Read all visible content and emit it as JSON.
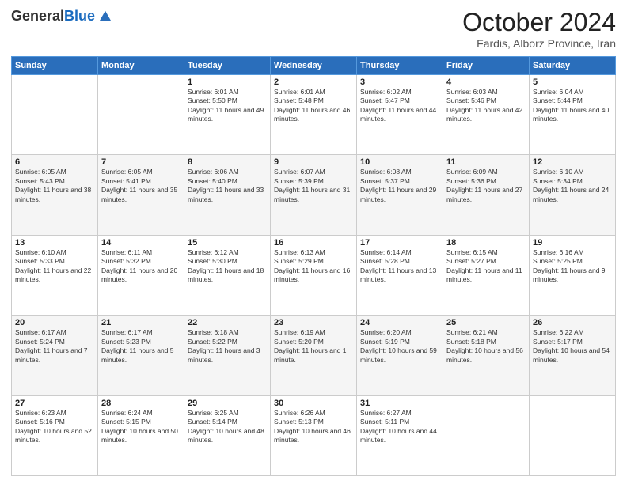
{
  "header": {
    "logo_general": "General",
    "logo_blue": "Blue",
    "month_title": "October 2024",
    "subtitle": "Fardis, Alborz Province, Iran"
  },
  "days_of_week": [
    "Sunday",
    "Monday",
    "Tuesday",
    "Wednesday",
    "Thursday",
    "Friday",
    "Saturday"
  ],
  "weeks": [
    {
      "days": [
        {
          "num": "",
          "info": ""
        },
        {
          "num": "",
          "info": ""
        },
        {
          "num": "1",
          "info": "Sunrise: 6:01 AM\nSunset: 5:50 PM\nDaylight: 11 hours and 49 minutes."
        },
        {
          "num": "2",
          "info": "Sunrise: 6:01 AM\nSunset: 5:48 PM\nDaylight: 11 hours and 46 minutes."
        },
        {
          "num": "3",
          "info": "Sunrise: 6:02 AM\nSunset: 5:47 PM\nDaylight: 11 hours and 44 minutes."
        },
        {
          "num": "4",
          "info": "Sunrise: 6:03 AM\nSunset: 5:46 PM\nDaylight: 11 hours and 42 minutes."
        },
        {
          "num": "5",
          "info": "Sunrise: 6:04 AM\nSunset: 5:44 PM\nDaylight: 11 hours and 40 minutes."
        }
      ]
    },
    {
      "days": [
        {
          "num": "6",
          "info": "Sunrise: 6:05 AM\nSunset: 5:43 PM\nDaylight: 11 hours and 38 minutes."
        },
        {
          "num": "7",
          "info": "Sunrise: 6:05 AM\nSunset: 5:41 PM\nDaylight: 11 hours and 35 minutes."
        },
        {
          "num": "8",
          "info": "Sunrise: 6:06 AM\nSunset: 5:40 PM\nDaylight: 11 hours and 33 minutes."
        },
        {
          "num": "9",
          "info": "Sunrise: 6:07 AM\nSunset: 5:39 PM\nDaylight: 11 hours and 31 minutes."
        },
        {
          "num": "10",
          "info": "Sunrise: 6:08 AM\nSunset: 5:37 PM\nDaylight: 11 hours and 29 minutes."
        },
        {
          "num": "11",
          "info": "Sunrise: 6:09 AM\nSunset: 5:36 PM\nDaylight: 11 hours and 27 minutes."
        },
        {
          "num": "12",
          "info": "Sunrise: 6:10 AM\nSunset: 5:34 PM\nDaylight: 11 hours and 24 minutes."
        }
      ]
    },
    {
      "days": [
        {
          "num": "13",
          "info": "Sunrise: 6:10 AM\nSunset: 5:33 PM\nDaylight: 11 hours and 22 minutes."
        },
        {
          "num": "14",
          "info": "Sunrise: 6:11 AM\nSunset: 5:32 PM\nDaylight: 11 hours and 20 minutes."
        },
        {
          "num": "15",
          "info": "Sunrise: 6:12 AM\nSunset: 5:30 PM\nDaylight: 11 hours and 18 minutes."
        },
        {
          "num": "16",
          "info": "Sunrise: 6:13 AM\nSunset: 5:29 PM\nDaylight: 11 hours and 16 minutes."
        },
        {
          "num": "17",
          "info": "Sunrise: 6:14 AM\nSunset: 5:28 PM\nDaylight: 11 hours and 13 minutes."
        },
        {
          "num": "18",
          "info": "Sunrise: 6:15 AM\nSunset: 5:27 PM\nDaylight: 11 hours and 11 minutes."
        },
        {
          "num": "19",
          "info": "Sunrise: 6:16 AM\nSunset: 5:25 PM\nDaylight: 11 hours and 9 minutes."
        }
      ]
    },
    {
      "days": [
        {
          "num": "20",
          "info": "Sunrise: 6:17 AM\nSunset: 5:24 PM\nDaylight: 11 hours and 7 minutes."
        },
        {
          "num": "21",
          "info": "Sunrise: 6:17 AM\nSunset: 5:23 PM\nDaylight: 11 hours and 5 minutes."
        },
        {
          "num": "22",
          "info": "Sunrise: 6:18 AM\nSunset: 5:22 PM\nDaylight: 11 hours and 3 minutes."
        },
        {
          "num": "23",
          "info": "Sunrise: 6:19 AM\nSunset: 5:20 PM\nDaylight: 11 hours and 1 minute."
        },
        {
          "num": "24",
          "info": "Sunrise: 6:20 AM\nSunset: 5:19 PM\nDaylight: 10 hours and 59 minutes."
        },
        {
          "num": "25",
          "info": "Sunrise: 6:21 AM\nSunset: 5:18 PM\nDaylight: 10 hours and 56 minutes."
        },
        {
          "num": "26",
          "info": "Sunrise: 6:22 AM\nSunset: 5:17 PM\nDaylight: 10 hours and 54 minutes."
        }
      ]
    },
    {
      "days": [
        {
          "num": "27",
          "info": "Sunrise: 6:23 AM\nSunset: 5:16 PM\nDaylight: 10 hours and 52 minutes."
        },
        {
          "num": "28",
          "info": "Sunrise: 6:24 AM\nSunset: 5:15 PM\nDaylight: 10 hours and 50 minutes."
        },
        {
          "num": "29",
          "info": "Sunrise: 6:25 AM\nSunset: 5:14 PM\nDaylight: 10 hours and 48 minutes."
        },
        {
          "num": "30",
          "info": "Sunrise: 6:26 AM\nSunset: 5:13 PM\nDaylight: 10 hours and 46 minutes."
        },
        {
          "num": "31",
          "info": "Sunrise: 6:27 AM\nSunset: 5:11 PM\nDaylight: 10 hours and 44 minutes."
        },
        {
          "num": "",
          "info": ""
        },
        {
          "num": "",
          "info": ""
        }
      ]
    }
  ]
}
